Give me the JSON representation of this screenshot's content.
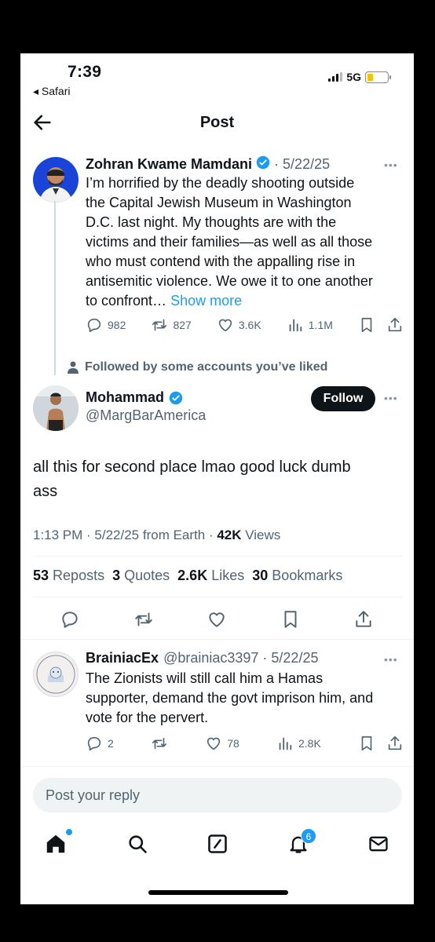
{
  "status_bar": {
    "time": "7:39",
    "back_app": "◂ Safari",
    "network": "5G"
  },
  "header": {
    "title": "Post"
  },
  "parent_post": {
    "author_name": "Zohran Kwame Mamdani",
    "date": "· 5/22/25",
    "text_lines": [
      "I’m horrified by the deadly shooting outside",
      "the Capital Jewish Museum in Washington",
      "D.C. last night. My thoughts are with the",
      "victims and their families—as well as all those",
      "who must contend with the appalling rise in",
      "antisemitic violence. We owe it to one another",
      "to confront… "
    ],
    "show_more": "Show more",
    "replies": "982",
    "reposts": "827",
    "likes": "3.6K",
    "views": "1.1M"
  },
  "social_context": "Followed by some accounts you’ve liked",
  "main_post": {
    "author_name": "Mohammad",
    "handle": "@MargBarAmerica",
    "follow_label": "Follow",
    "text_line1": "all this for second place lmao good luck dumb",
    "text_line2": "ass",
    "meta_prefix": "1:13 PM · 5/22/25 from Earth · ",
    "views_count": "42K",
    "views_label": " Views",
    "stats": {
      "reposts_count": "53",
      "reposts_label": "Reposts",
      "quotes_count": "3",
      "quotes_label": "Quotes",
      "likes_count": "2.6K",
      "likes_label": "Likes",
      "bookmarks_count": "30",
      "bookmarks_label": "Bookmarks"
    }
  },
  "reply_post": {
    "author_name": "BrainiacEx",
    "handle_date": "@brainiac3397 · 5/22/25",
    "text_lines": [
      "The Zionists will still call him a Hamas",
      "supporter, demand the govt imprison him, and",
      "vote for the pervert."
    ],
    "replies": "2",
    "likes": "78",
    "views": "2.8K"
  },
  "composer": {
    "placeholder": "Post your reply"
  },
  "bottom_nav": {
    "notification_count": "6"
  },
  "colors": {
    "accent": "#1d9bf0",
    "text": "#0f1419",
    "muted": "#536471",
    "battery": "#f5c400"
  }
}
